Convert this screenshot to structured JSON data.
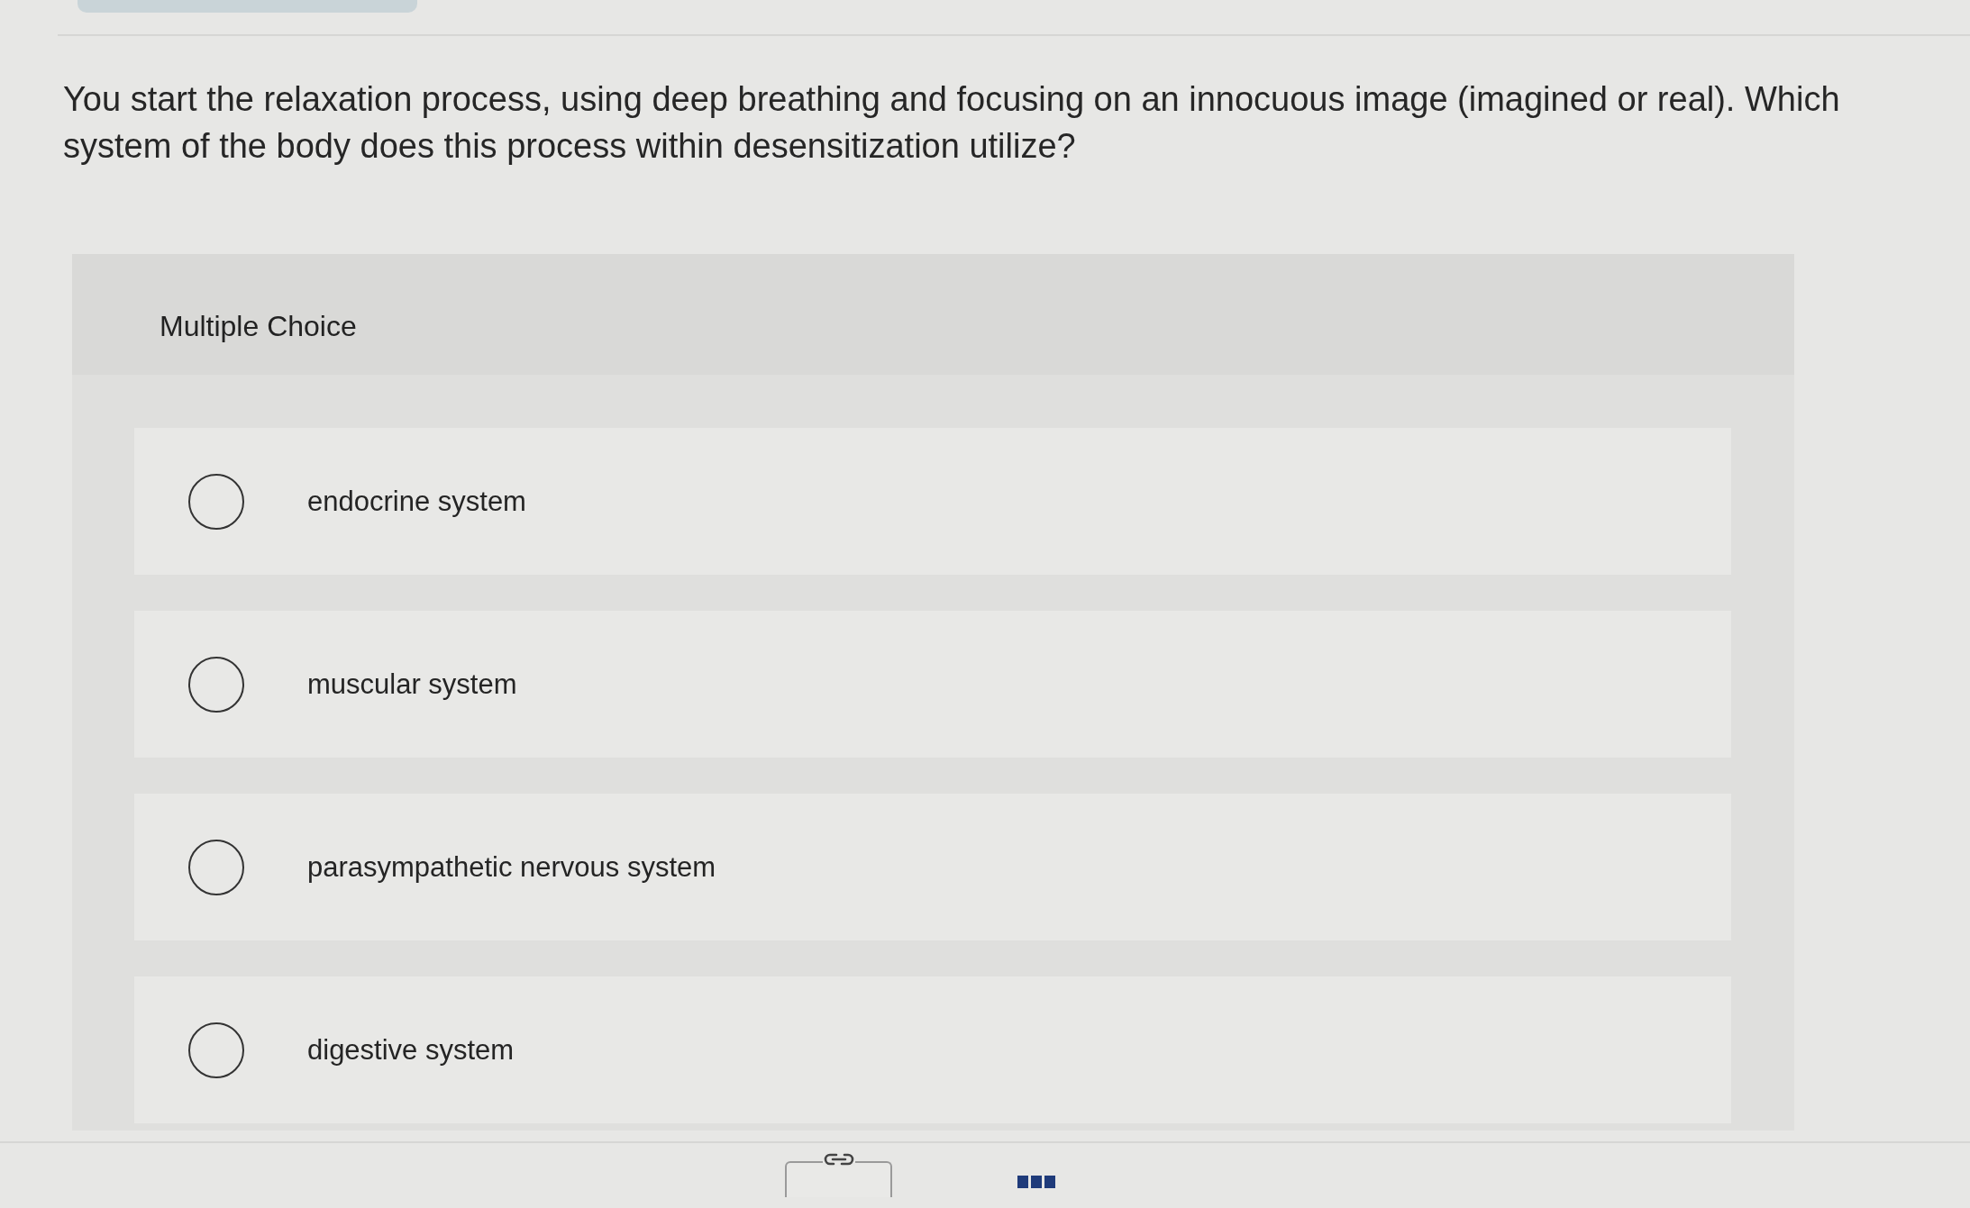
{
  "question": {
    "text": "You start the relaxation process, using deep breathing and focusing on an innocuous image (imagined or real). Which system of the body does this process within desensitization utilize?"
  },
  "answer_panel": {
    "header": "Multiple Choice",
    "choices": [
      {
        "label": "endocrine system",
        "selected": false
      },
      {
        "label": "muscular system",
        "selected": false
      },
      {
        "label": "parasympathetic nervous system",
        "selected": false
      },
      {
        "label": "digestive system",
        "selected": false
      }
    ]
  }
}
